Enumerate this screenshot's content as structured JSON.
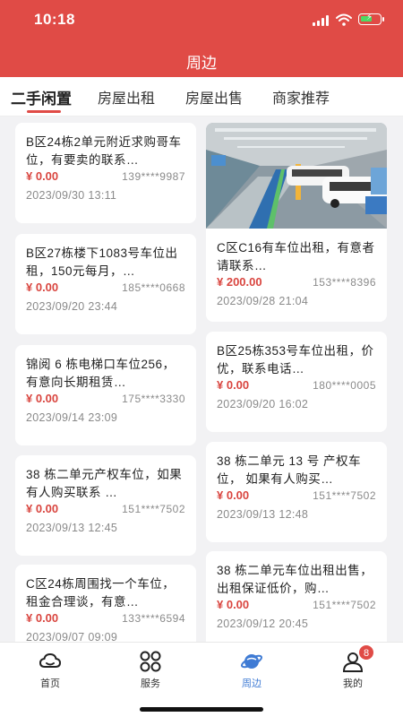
{
  "status_bar": {
    "time": "10:18"
  },
  "header": {
    "title": "周边"
  },
  "tabs": [
    {
      "label": "二手闲置"
    },
    {
      "label": "房屋出租"
    },
    {
      "label": "房屋出售"
    },
    {
      "label": "商家推荐"
    }
  ],
  "left_cards": [
    {
      "title": "B区24栋2单元附近求购哥车位，有要卖的联系…",
      "price": "¥ 0.00",
      "phone": "139****9987",
      "date": "2023/09/30 13:11"
    },
    {
      "title": "B区27栋楼下1083号车位出租，150元每月，…",
      "price": "¥ 0.00",
      "phone": "185****0668",
      "date": "2023/09/20 23:44"
    },
    {
      "title": "锦阅 6 栋电梯口车位256，有意向长期租赁…",
      "price": "¥ 0.00",
      "phone": "175****3330",
      "date": "2023/09/14 23:09"
    },
    {
      "title": "38 栋二单元产权车位，如果有人购买联系 …",
      "price": "¥ 0.00",
      "phone": "151****7502",
      "date": "2023/09/13 12:45"
    },
    {
      "title": "C区24栋周围找一个车位，租金合理谈，有意…",
      "price": "¥ 0.00",
      "phone": "133****6594",
      "date": "2023/09/07 09:09"
    }
  ],
  "right_cards": [
    {
      "title": "C区C16有车位出租，有意者请联系…",
      "price": "¥ 200.00",
      "phone": "153****8396",
      "date": "2023/09/28 21:04",
      "image": "parking-garage-photo"
    },
    {
      "title": "B区25栋353号车位出租，价优，联系电话…",
      "price": "¥ 0.00",
      "phone": "180****0005",
      "date": "2023/09/20 16:02"
    },
    {
      "title": "38 栋二单元 13 号 产权车位， 如果有人购买…",
      "price": "¥ 0.00",
      "phone": "151****7502",
      "date": "2023/09/13 12:48"
    },
    {
      "title": "38 栋二单元车位出租出售，出租保证低价，购…",
      "price": "¥ 0.00",
      "phone": "151****7502",
      "date": "2023/09/12 20:45"
    }
  ],
  "bottom_nav": [
    {
      "label": "首页",
      "icon": "cloud-home-icon"
    },
    {
      "label": "服务",
      "icon": "services-grid-icon"
    },
    {
      "label": "周边",
      "icon": "planet-nearby-icon",
      "active": true
    },
    {
      "label": "我的",
      "icon": "user-profile-icon",
      "badge": "8"
    }
  ],
  "colors": {
    "brand": "#e04b46",
    "price": "#d9453f",
    "active_nav": "#3f7bd4"
  }
}
